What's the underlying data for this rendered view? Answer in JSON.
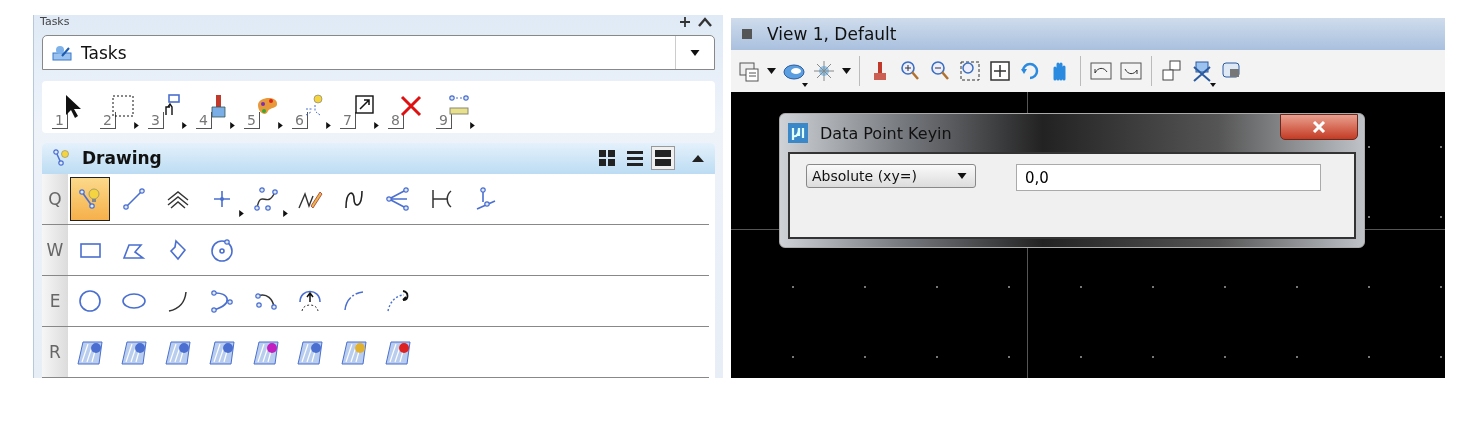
{
  "tasks_panel": {
    "title": "Tasks",
    "task_dropdown": {
      "value": "Tasks"
    },
    "task_tools": [
      {
        "number": "1"
      },
      {
        "number": "2"
      },
      {
        "number": "3"
      },
      {
        "number": "4"
      },
      {
        "number": "5"
      },
      {
        "number": "6"
      },
      {
        "number": "7"
      },
      {
        "number": "8"
      },
      {
        "number": "9"
      }
    ],
    "section": {
      "title": "Drawing",
      "expanded": true,
      "view_modes": [
        {
          "selected": false
        },
        {
          "selected": false
        },
        {
          "selected": true
        }
      ]
    },
    "tool_rows": [
      {
        "key": "Q",
        "tools": [
          {
            "selected": true
          },
          {
            "selected": false
          },
          {
            "selected": false
          },
          {
            "selected": false
          },
          {
            "selected": false
          },
          {
            "selected": false
          },
          {
            "selected": false
          },
          {
            "selected": false
          },
          {
            "selected": false
          },
          {
            "selected": false
          }
        ]
      },
      {
        "key": "W",
        "tools": [
          {
            "selected": false
          },
          {
            "selected": false
          },
          {
            "selected": false
          },
          {
            "selected": false
          }
        ]
      },
      {
        "key": "E",
        "tools": [
          {
            "selected": false
          },
          {
            "selected": false
          },
          {
            "selected": false
          },
          {
            "selected": false
          },
          {
            "selected": false
          },
          {
            "selected": false
          },
          {
            "selected": false
          },
          {
            "selected": false
          }
        ]
      },
      {
        "key": "R",
        "tools": [
          {
            "selected": false
          },
          {
            "selected": false
          },
          {
            "selected": false
          },
          {
            "selected": false
          },
          {
            "selected": false
          },
          {
            "selected": false
          },
          {
            "selected": false
          },
          {
            "selected": false
          }
        ]
      }
    ]
  },
  "view": {
    "title": "View 1, Default",
    "dialog": {
      "title": "Data Point Keyin",
      "mode_dropdown": {
        "value": "Absolute (xy=)"
      },
      "coordinate_field": {
        "value": "0,0"
      }
    }
  }
}
